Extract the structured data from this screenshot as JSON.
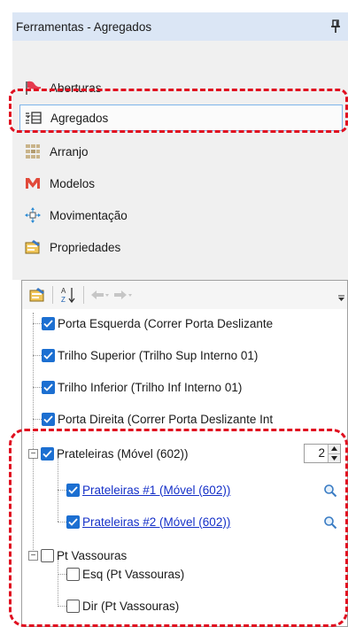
{
  "panel": {
    "title": "Ferramentas - Agregados",
    "pin_icon": "pin-icon"
  },
  "nav": {
    "items": [
      {
        "label": "Aberturas",
        "icon": "flag-icon"
      },
      {
        "label": "Agregados",
        "icon": "aggregate-icon",
        "selected": true
      },
      {
        "label": "Arranjo",
        "icon": "grid-icon"
      },
      {
        "label": "Modelos",
        "icon": "model-m-icon"
      },
      {
        "label": "Movimentação",
        "icon": "move-icon"
      },
      {
        "label": "Propriedades",
        "icon": "properties-icon"
      }
    ]
  },
  "tree": {
    "toolbar_icons": [
      "properties-icon",
      "sort-az-icon",
      "back-icon",
      "forward-icon",
      "overflow-icon"
    ],
    "items": [
      {
        "label": "Porta Esquerda (Correr Porta Deslizante",
        "checked": true
      },
      {
        "label": "Trilho Superior (Trilho Sup Interno 01)",
        "checked": true
      },
      {
        "label": "Trilho Inferior (Trilho Inf Interno 01)",
        "checked": true
      },
      {
        "label": "Porta Direita (Correr Porta Deslizante Int",
        "checked": true
      },
      {
        "label": "Prateleiras (Móvel (602))",
        "checked": true,
        "expander": "−",
        "stepper_value": "2"
      },
      {
        "label": "Prateleiras #1 (Móvel (602))",
        "checked": true,
        "link": true
      },
      {
        "label": "Prateleiras #2 (Móvel (602))",
        "checked": true,
        "link": true
      },
      {
        "label": "Pt Vassouras",
        "checked": false,
        "expander": "−"
      },
      {
        "label": "Esq (Pt Vassouras)",
        "checked": false
      },
      {
        "label": "Dir (Pt Vassouras)",
        "checked": false
      }
    ]
  },
  "colors": {
    "highlight": "#e01020",
    "check_fill": "#1c6fd1",
    "link": "#1530c8",
    "title_bg": "#dbe6f5"
  }
}
